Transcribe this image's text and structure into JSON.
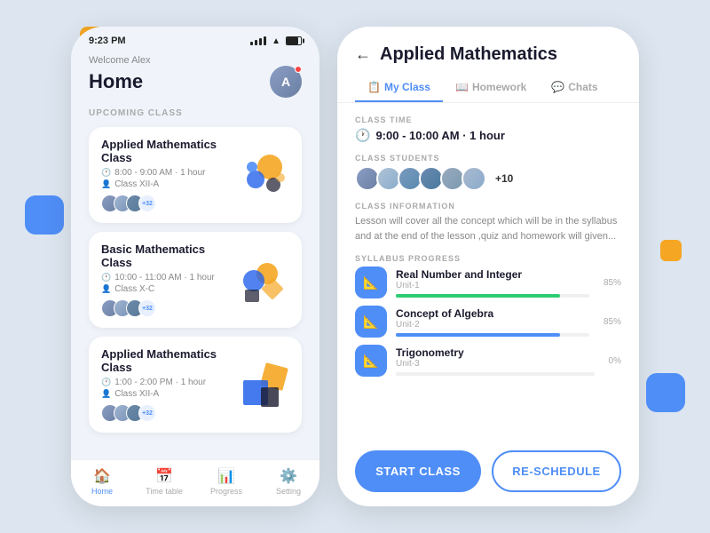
{
  "decorative": {
    "blobs": [
      "orange-top-left",
      "blue-left",
      "navy-left",
      "orange-right",
      "blue-right"
    ]
  },
  "left_phone": {
    "status_bar": {
      "time": "9:23 PM"
    },
    "header": {
      "welcome": "Welcome Alex",
      "title": "Home",
      "avatar_initials": "A"
    },
    "upcoming_section": {
      "label": "UPCOMING CLASS",
      "classes": [
        {
          "name": "Applied Mathematics Class",
          "time": "8:00 - 9:00 AM · 1 hour",
          "group": "Class XII-A",
          "count": "+32"
        },
        {
          "name": "Basic Mathematics Class",
          "time": "10:00 - 11:00 AM · 1 hour",
          "group": "Class X-C",
          "count": "+32"
        },
        {
          "name": "Applied Mathematics Class",
          "time": "1:00 - 2:00 PM · 1 hour",
          "group": "Class XII-A",
          "count": "+32"
        }
      ]
    },
    "bottom_nav": [
      {
        "id": "home",
        "label": "Home",
        "icon": "🏠",
        "active": true
      },
      {
        "id": "timetable",
        "label": "Time table",
        "icon": "📅",
        "active": false
      },
      {
        "id": "progress",
        "label": "Progress",
        "icon": "📊",
        "active": false
      },
      {
        "id": "setting",
        "label": "Setting",
        "icon": "⚙️",
        "active": false
      }
    ]
  },
  "right_panel": {
    "header": {
      "back_label": "←",
      "title": "Applied Mathematics"
    },
    "tabs": [
      {
        "id": "my-class",
        "label": "My Class",
        "active": true,
        "icon": "📋"
      },
      {
        "id": "homework",
        "label": "Homework",
        "active": false,
        "icon": "📖"
      },
      {
        "id": "chats",
        "label": "Chats",
        "active": false,
        "icon": "💬"
      }
    ],
    "class_time": {
      "label": "CLASS TIME",
      "value": "9:00 - 10:00 AM · 1 hour"
    },
    "class_students": {
      "label": "CLASS STUDENTS",
      "count": "+10"
    },
    "class_information": {
      "label": "CLASS INFORMATION",
      "text": "Lesson will cover all the concept which will be in the syllabus and at the end of the lesson ,quiz and homework will given..."
    },
    "syllabus_progress": {
      "label": "SYLLABUS PROGRESS",
      "items": [
        {
          "name": "Real Number and Integer",
          "unit": "Unit-1",
          "progress": 85,
          "color": "green"
        },
        {
          "name": "Concept of Algebra",
          "unit": "Unit-2",
          "progress": 85,
          "color": "blue"
        },
        {
          "name": "Trigonometry",
          "unit": "Unit-3",
          "progress": 0,
          "color": "blue"
        }
      ]
    },
    "footer": {
      "start_label": "START CLASS",
      "reschedule_label": "RE-SCHEDULE"
    }
  }
}
